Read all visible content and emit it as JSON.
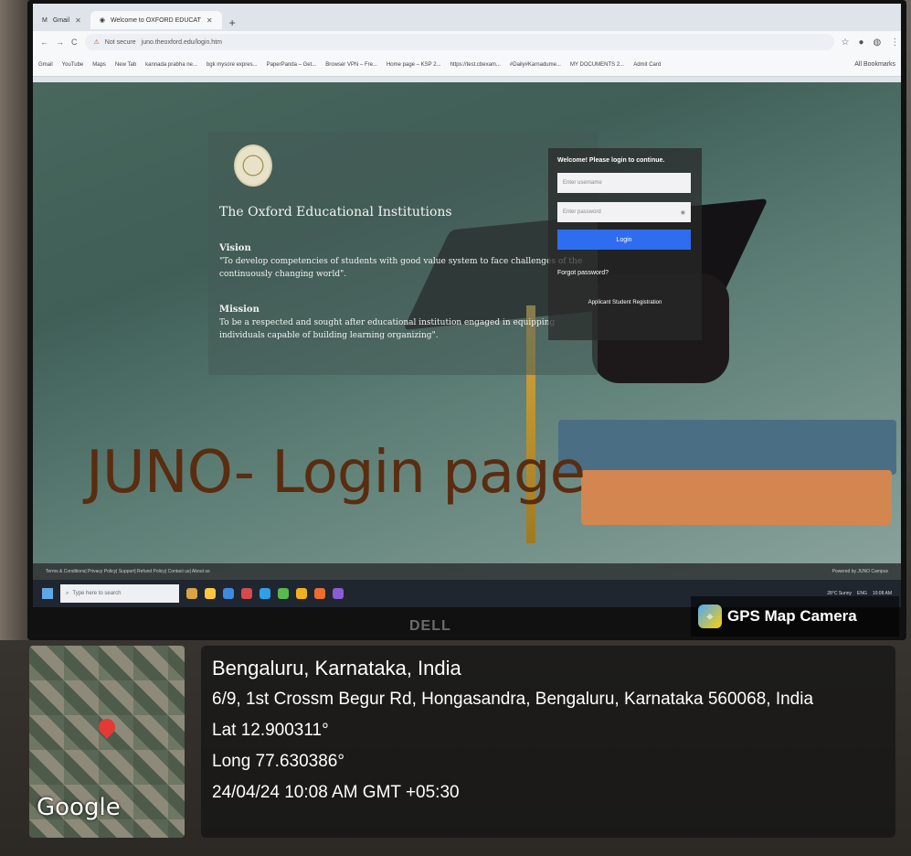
{
  "browser": {
    "tabs": [
      {
        "label": "Gmail",
        "active": false
      },
      {
        "label": "Welcome to OXFORD EDUCAT",
        "active": true
      }
    ],
    "address": {
      "security": "Not secure",
      "url": "juno.theoxford.edu/login.htm"
    },
    "bookmarks": [
      "Gmail",
      "YouTube",
      "Maps",
      "New Tab",
      "kannada prabha ne...",
      "bgk mysore expres...",
      "PaperPanda – Get...",
      "Browser VPN – Fre...",
      "Home page – KSP 2...",
      "https://test.cbexam...",
      "#Daily#Karnadume...",
      "MY DOCUMENTS 2...",
      "Admit Card"
    ],
    "all_bookmarks": "All Bookmarks"
  },
  "institution": {
    "name": "The Oxford Educational Institutions",
    "vision_title": "Vision",
    "vision_text": "\"To develop competencies of students with good value system to face challenges of the continuously changing world\".",
    "mission_title": "Mission",
    "mission_text": "To be a respected and sought after educational institution engaged in equipping individuals capable of building learning organizing\"."
  },
  "login": {
    "title": "Welcome! Please login to continue.",
    "username_placeholder": "Enter username",
    "password_placeholder": "Enter password",
    "login_button": "Login",
    "forgot": "Forgot password?",
    "register": "Applicant Student Registration"
  },
  "banner": "JUNO- Login page",
  "footer": {
    "links": "Terms & Conditions| Privacy Policy| Support| Refund Policy| Contact us| About us",
    "powered": "Powered by JUNO Campus"
  },
  "taskbar": {
    "search_placeholder": "Type here to search",
    "weather": "28°C Sunny",
    "lang": "ENG",
    "time": "10:08 AM"
  },
  "monitor_brand": "DELL",
  "gps": {
    "badge": "GPS Map Camera",
    "city": "Bengaluru, Karnataka, India",
    "address": "6/9, 1st Crossm Begur Rd, Hongasandra, Bengaluru, Karnataka 560068, India",
    "lat": "Lat 12.900311°",
    "long": "Long 77.630386°",
    "datetime": "24/04/24 10:08 AM GMT +05:30",
    "map_brand": "Google"
  }
}
